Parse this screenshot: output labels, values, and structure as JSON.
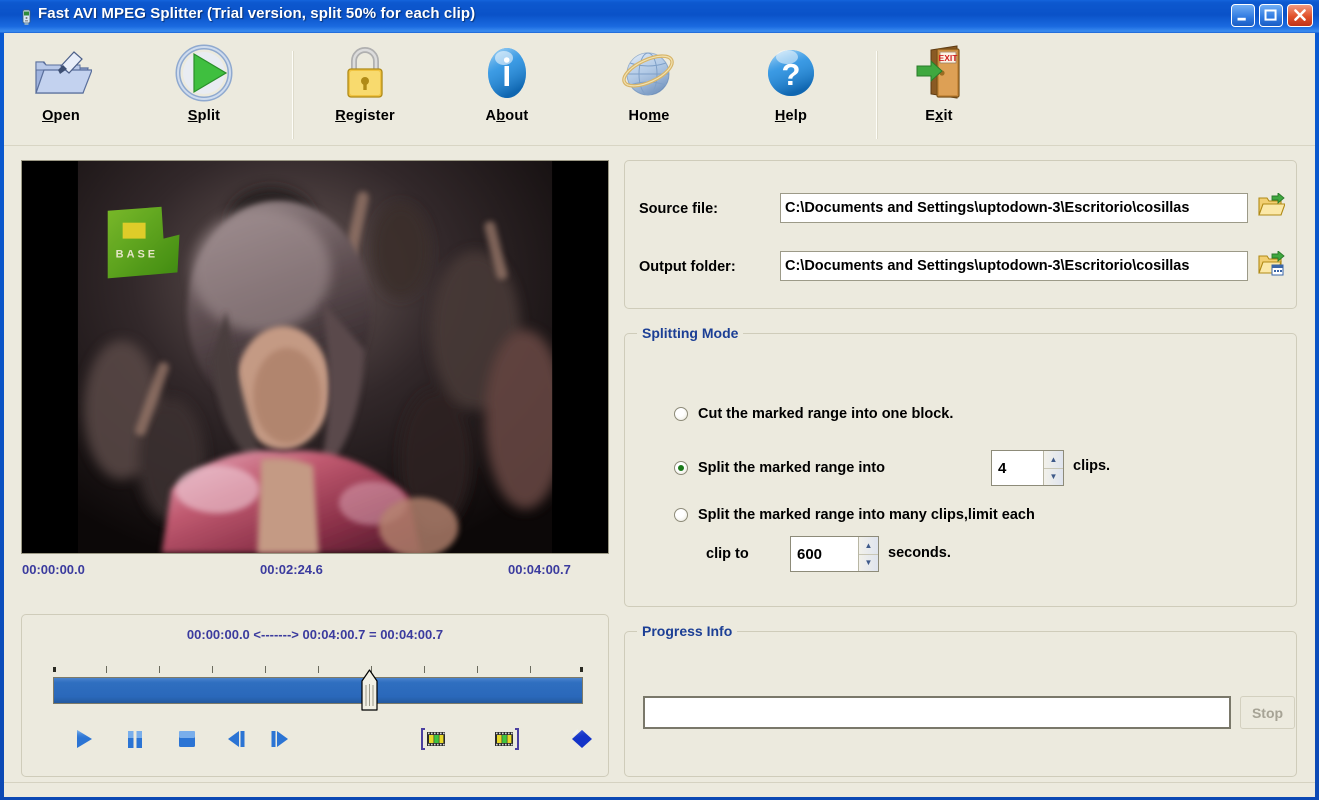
{
  "window": {
    "title": "Fast AVI MPEG Splitter (Trial version, split 50% for each clip)",
    "minimize_label": "Minimize",
    "maximize_label": "Maximize",
    "close_label": "Close"
  },
  "toolbar": {
    "items": [
      {
        "name": "open",
        "label": "Open",
        "accel_index": 0,
        "icon": "open-folder-icon"
      },
      {
        "name": "split",
        "label": "Split",
        "accel_index": 0,
        "icon": "play-circle-icon"
      },
      {
        "name": "register",
        "label": "Register",
        "accel_index": 0,
        "icon": "padlock-icon"
      },
      {
        "name": "about",
        "label": "About",
        "accel_index": 1,
        "icon": "info-icon"
      },
      {
        "name": "home",
        "label": "Home",
        "accel_index": 2,
        "icon": "globe-icon"
      },
      {
        "name": "help",
        "label": "Help",
        "accel_index": 0,
        "icon": "question-mark-icon"
      },
      {
        "name": "exit",
        "label": "Exit",
        "accel_index": 1,
        "icon": "exit-door-icon"
      }
    ]
  },
  "preview": {
    "time_start": "00:00:00.0",
    "time_current": "00:02:24.6",
    "time_end": "00:04:00.7",
    "watermark": "BASE"
  },
  "trim": {
    "range_label": "00:00:00.0 <-------> 00:04:00.7 = 00:04:00.7",
    "slider_value_percent": 58,
    "tick_count": 11,
    "buttons": [
      {
        "name": "play",
        "icon": "play-icon"
      },
      {
        "name": "pause",
        "icon": "pause-icon"
      },
      {
        "name": "stop",
        "icon": "stop-icon"
      },
      {
        "name": "prev-frame",
        "icon": "previous-frame-icon"
      },
      {
        "name": "next-frame",
        "icon": "next-frame-icon"
      },
      {
        "name": "mark-start",
        "icon": "mark-start-icon"
      },
      {
        "name": "mark-end",
        "icon": "mark-end-icon"
      },
      {
        "name": "clear-marks",
        "icon": "blue-diamond-icon"
      }
    ]
  },
  "files": {
    "source_label": "Source file:",
    "source_value": "C:\\Documents and Settings\\uptodown-3\\Escritorio\\cosillas",
    "output_label": "Output folder:",
    "output_value": "C:\\Documents and Settings\\uptodown-3\\Escritorio\\cosillas",
    "browse_file_icon": "open-folder-icon",
    "browse_folder_icon": "open-folder-calendar-icon"
  },
  "splitting_mode": {
    "title": "Splitting Mode",
    "option_one_block": "Cut the marked range into one block.",
    "option_n_clips": "Split the marked range into",
    "clips_suffix": "clips.",
    "clips_value": "4",
    "option_by_seconds": "Split the marked range into many clips,limit each",
    "clip_to_label": "clip to",
    "seconds_value": "600",
    "seconds_suffix": "seconds.",
    "selected": "n_clips"
  },
  "progress": {
    "title": "Progress Info",
    "bar_value": "",
    "stop_label": "Stop",
    "stop_enabled": false
  },
  "colors": {
    "title_blue": "#0a55c8",
    "group_title_blue": "#1c3f95",
    "time_text_blue": "#3b3b9e",
    "panel_bg": "#eceade",
    "slider_blue": "#2f6fc0",
    "radio_selected_green": "#1a7a1a",
    "close_red": "#e0512b"
  }
}
